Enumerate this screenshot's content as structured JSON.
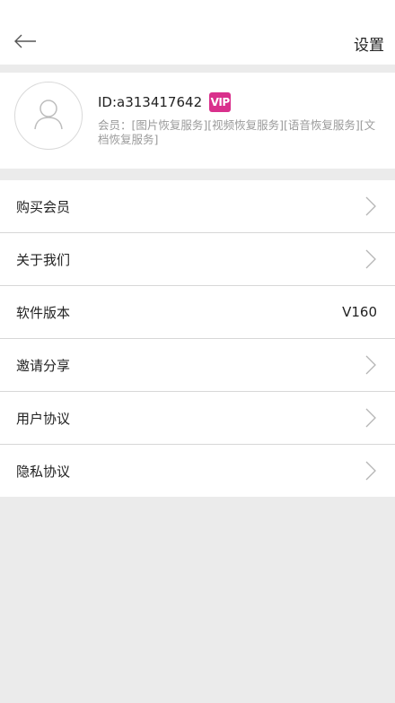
{
  "header": {
    "title": "设置",
    "back_icon": "arrow-left-icon"
  },
  "profile": {
    "user_id": "ID:a313417642",
    "vip_badge": "VIP",
    "member_text": "会员：[图片恢复服务][视频恢复服务][语音恢复服务][文档恢复服务]",
    "avatar_icon": "user-avatar-icon"
  },
  "menu": {
    "items": [
      {
        "label": "购买会员",
        "right": "chevron-right-icon"
      },
      {
        "label": "关于我们",
        "right": "chevron-right-icon"
      },
      {
        "label": "软件版本",
        "value": "V160"
      },
      {
        "label": "邀请分享",
        "right": "chevron-right-icon"
      },
      {
        "label": "用户协议",
        "right": "chevron-right-icon"
      },
      {
        "label": "隐私协议",
        "right": "chevron-right-icon"
      }
    ]
  },
  "colors": {
    "vip": "#d9308c",
    "background": "#ebebeb",
    "divider": "#d7d7d7"
  }
}
